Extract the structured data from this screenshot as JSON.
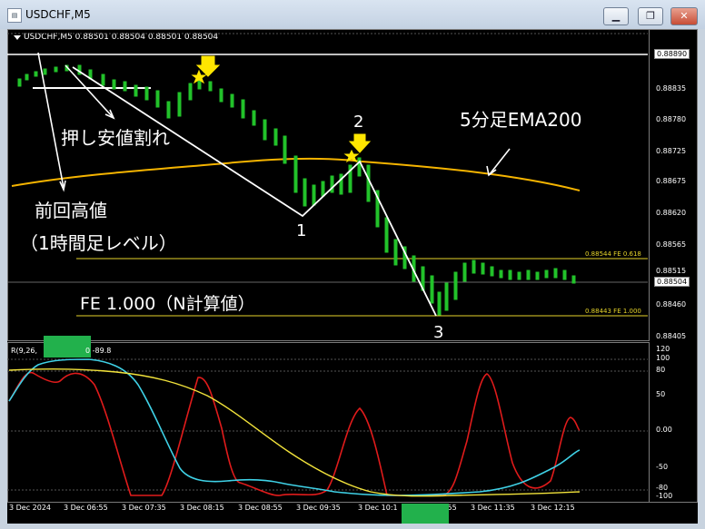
{
  "window": {
    "title": "USDCHF,M5",
    "min": "▁",
    "restore": "❐",
    "close": "✕"
  },
  "chart_header": "USDCHF,M5  0.88501 0.88504 0.88501 0.88504",
  "price_axis": [
    "0.88890",
    "0.88835",
    "0.88780",
    "0.88725",
    "0.88675",
    "0.88620",
    "0.88565",
    "0.88515",
    "0.88504",
    "0.88460",
    "0.88405"
  ],
  "current_price": "0.88504",
  "fe_levels": {
    "fe618": "0.88544  FE 0.618",
    "fe1000": "0.88443  FE 1.000"
  },
  "annotations": {
    "pushback_break": "押し安値割れ",
    "prev_high": "前回高値",
    "prev_high_sub": "（1時間足レベル）",
    "ema": "5分足EMA200",
    "fe_calc": "FE 1.000（N計算値）",
    "p1": "1",
    "p2": "2",
    "p3": "3"
  },
  "rci_header": "R(9,26,",
  "rci_header_tail": "0 -89.8",
  "rci_axis": [
    "120",
    "100",
    "80",
    "50",
    "0.00",
    "-50",
    "-80",
    "-100"
  ],
  "time_axis": [
    "3 Dec 2024",
    "3 Dec 06:55",
    "3 Dec 07:35",
    "3 Dec 08:15",
    "3 Dec 08:55",
    "3 Dec 09:35",
    "3 Dec 10:1",
    "3 Dec 10:55",
    "3 Dec 11:35",
    "3 Dec 12:15"
  ],
  "colors": {
    "ema": "#f5b400",
    "rci_short": "#e01b1b",
    "rci_mid": "#3fd1e6",
    "rci_long": "#f2e33b",
    "fe_line": "#e6d42a",
    "candle": "#22c22a",
    "arrow": "#ffe600"
  }
}
